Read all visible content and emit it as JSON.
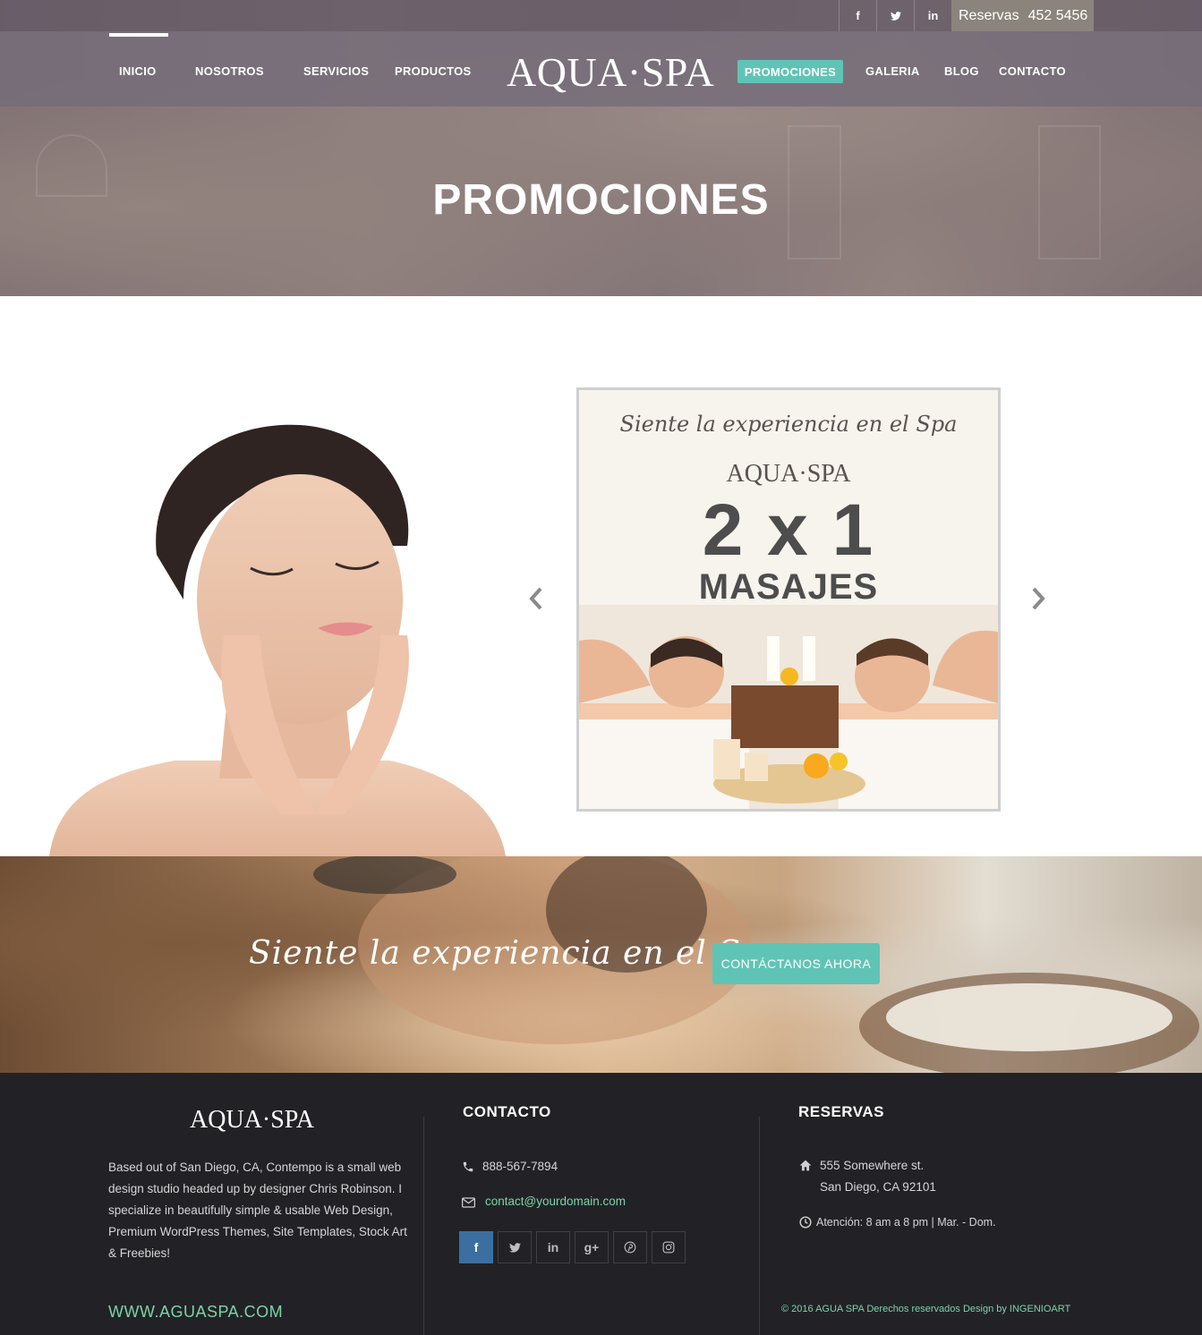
{
  "topbar": {
    "social": [
      {
        "icon": "facebook-icon",
        "glyph": "f"
      },
      {
        "icon": "twitter-icon",
        "glyph": "t"
      },
      {
        "icon": "linkedin-icon",
        "glyph": "in"
      }
    ],
    "reservas_label": "Reservas",
    "reservas_phone": "452 5456"
  },
  "nav": {
    "items": [
      "INICIO",
      "NOSOTROS",
      "SERVICIOS",
      "PRODUCTOS",
      "PROMOCIONES",
      "GALERIA",
      "BLOG",
      "CONTACTO"
    ],
    "active_index": 4,
    "logo": "AQUA·SPA"
  },
  "hero": {
    "title": "PROMOCIONES"
  },
  "promo_card": {
    "script": "Siente la experiencia en el Spa",
    "logo": "AQUA·SPA",
    "offer": "2 x 1",
    "subtitle": "MASAJES"
  },
  "carousel": {
    "prev_icon": "chevron-left-icon",
    "next_icon": "chevron-right-icon"
  },
  "banner": {
    "script": "Siente la experiencia en el Spa",
    "button_label": "CONTÁCTANOS AHORA"
  },
  "footer": {
    "logo": "AQUA·SPA",
    "about": "Based out of San Diego, CA, Contempo is a small web design studio headed up by designer Chris Robinson. I specialize in beautifully simple & usable Web Design, Premium WordPress Themes, Site Templates, Stock Art & Freebies!",
    "website": "WWW.AGUASPA.COM",
    "contacto_heading": "CONTACTO",
    "phone": "888-567-7894",
    "email": "contact@yourdomain.com",
    "social": [
      {
        "icon": "facebook-icon",
        "glyph": "f"
      },
      {
        "icon": "twitter-icon",
        "glyph": "t"
      },
      {
        "icon": "linkedin-icon",
        "glyph": "in"
      },
      {
        "icon": "google-plus-icon",
        "glyph": "g+"
      },
      {
        "icon": "pinterest-icon",
        "glyph": "p"
      },
      {
        "icon": "instagram-icon",
        "glyph": "◘"
      }
    ],
    "reservas_heading": "RESERVAS",
    "address_line1": "555 Somewhere st.",
    "address_line2": "San Diego, CA 92101",
    "hours": "Atención: 8 am a 8 pm  |  Mar. - Dom.",
    "copyright": "© 2016   AGUA SPA   Derechos reservados Design by INGENIOART"
  },
  "colors": {
    "accent": "#5fc4b6",
    "footer_bg": "#222226",
    "footer_link": "#7dd3a8",
    "nav_overlay": "#756c7a"
  }
}
